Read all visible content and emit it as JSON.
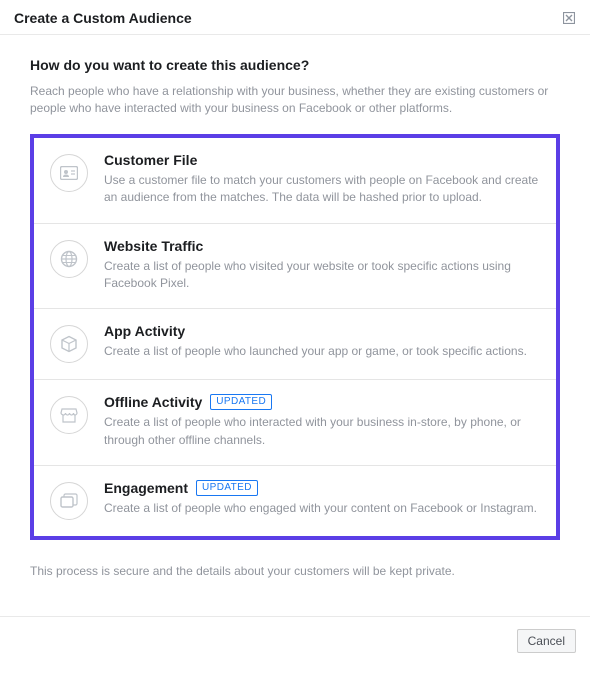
{
  "header": {
    "title": "Create a Custom Audience"
  },
  "question": "How do you want to create this audience?",
  "lead": "Reach people who have a relationship with your business, whether they are existing customers or people who have interacted with your business on Facebook or other platforms.",
  "options": [
    {
      "title": "Customer File",
      "badge": "",
      "desc": "Use a customer file to match your customers with people on Facebook and create an audience from the matches. The data will be hashed prior to upload."
    },
    {
      "title": "Website Traffic",
      "badge": "",
      "desc": "Create a list of people who visited your website or took specific actions using Facebook Pixel."
    },
    {
      "title": "App Activity",
      "badge": "",
      "desc": "Create a list of people who launched your app or game, or took specific actions."
    },
    {
      "title": "Offline Activity",
      "badge": "UPDATED",
      "desc": "Create a list of people who interacted with your business in-store, by phone, or through other offline channels."
    },
    {
      "title": "Engagement",
      "badge": "UPDATED",
      "desc": "Create a list of people who engaged with your content on Facebook or Instagram."
    }
  ],
  "note": "This process is secure and the details about your customers will be kept private.",
  "footer": {
    "cancel_label": "Cancel"
  }
}
